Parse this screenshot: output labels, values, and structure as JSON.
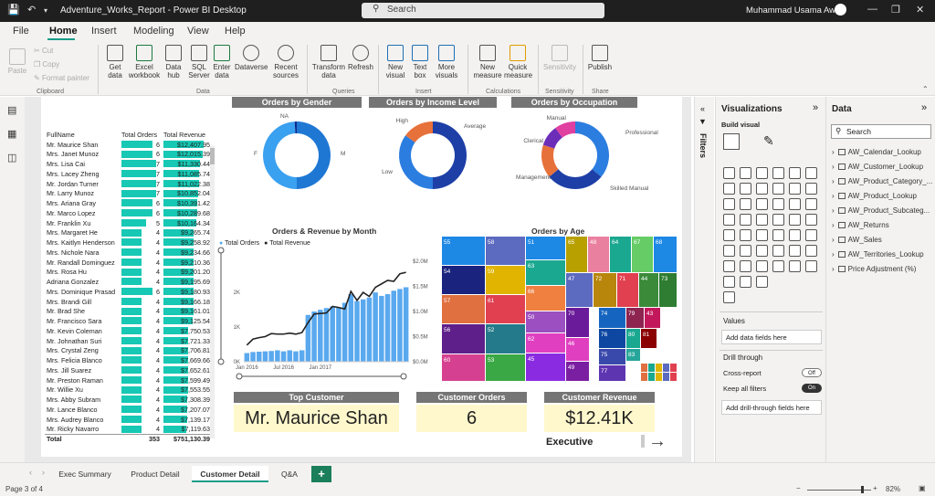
{
  "titlebar": {
    "title": "Adventure_Works_Report - Power BI Desktop",
    "search": "Search",
    "user": "Muhammad Usama Awan"
  },
  "menu": [
    "File",
    "Home",
    "Insert",
    "Modeling",
    "View",
    "Help"
  ],
  "ribbon": {
    "clipboard": {
      "paste": "Paste",
      "cut": "Cut",
      "copy": "Copy",
      "format_painter": "Format painter",
      "group": "Clipboard"
    },
    "data": {
      "get_data": "Get data",
      "excel": "Excel workbook",
      "data_hub": "Data hub",
      "sql": "SQL Server",
      "enter": "Enter data",
      "dataverse": "Dataverse",
      "recent": "Recent sources",
      "group": "Data"
    },
    "queries": {
      "transform": "Transform data",
      "refresh": "Refresh",
      "group": "Queries"
    },
    "insert": {
      "new_visual": "New visual",
      "text_box": "Text box",
      "more_visuals": "More visuals",
      "group": "Insert"
    },
    "calculations": {
      "new_measure": "New measure",
      "quick_measure": "Quick measure",
      "group": "Calculations"
    },
    "sensitivity": {
      "label": "Sensitivity",
      "group": "Sensitivity"
    },
    "share": {
      "publish": "Publish",
      "group": "Share"
    }
  },
  "table": {
    "headers": [
      "FullName",
      "Total Orders",
      "Total Revenue"
    ],
    "rows": [
      {
        "name": "Mr. Maurice Shan",
        "orders": "6",
        "revenue": "$12,407.95",
        "ob": 0.9,
        "rb": 1.0
      },
      {
        "name": "Mrs. Janet Munoz",
        "orders": "6",
        "revenue": "$12,015.39",
        "ob": 0.9,
        "rb": 0.97
      },
      {
        "name": "Mrs. Lisa Cai",
        "orders": "7",
        "revenue": "$11,330.44",
        "ob": 1.0,
        "rb": 0.91
      },
      {
        "name": "Mrs. Lacey Zheng",
        "orders": "7",
        "revenue": "$11,085.74",
        "ob": 1.0,
        "rb": 0.89
      },
      {
        "name": "Mr. Jordan Turner",
        "orders": "7",
        "revenue": "$11,022.38",
        "ob": 1.0,
        "rb": 0.89
      },
      {
        "name": "Mr. Larry Munoz",
        "orders": "7",
        "revenue": "$10,852.04",
        "ob": 1.0,
        "rb": 0.87
      },
      {
        "name": "Mrs. Ariana Gray",
        "orders": "6",
        "revenue": "$10,391.42",
        "ob": 0.9,
        "rb": 0.84
      },
      {
        "name": "Mr. Marco Lopez",
        "orders": "6",
        "revenue": "$10,289.68",
        "ob": 0.9,
        "rb": 0.83
      },
      {
        "name": "Mr. Franklin Xu",
        "orders": "5",
        "revenue": "$10,164.34",
        "ob": 0.72,
        "rb": 0.82
      },
      {
        "name": "Mrs. Margaret He",
        "orders": "4",
        "revenue": "$9,265.74",
        "ob": 0.57,
        "rb": 0.75
      },
      {
        "name": "Mrs. Kaitlyn Henderson",
        "orders": "4",
        "revenue": "$9,258.92",
        "ob": 0.57,
        "rb": 0.75
      },
      {
        "name": "Mrs. Nichole Nara",
        "orders": "4",
        "revenue": "$9,234.66",
        "ob": 0.57,
        "rb": 0.74
      },
      {
        "name": "Mr. Randall Dominguez",
        "orders": "4",
        "revenue": "$9,210.36",
        "ob": 0.57,
        "rb": 0.74
      },
      {
        "name": "Mrs. Rosa Hu",
        "orders": "4",
        "revenue": "$9,201.20",
        "ob": 0.57,
        "rb": 0.74
      },
      {
        "name": "Adriana Gonzalez",
        "orders": "4",
        "revenue": "$9,195.69",
        "ob": 0.57,
        "rb": 0.74
      },
      {
        "name": "Mrs. Dominique Prasad",
        "orders": "6",
        "revenue": "$9,180.93",
        "ob": 0.9,
        "rb": 0.74
      },
      {
        "name": "Mrs. Brandi Gill",
        "orders": "4",
        "revenue": "$9,166.18",
        "ob": 0.57,
        "rb": 0.74
      },
      {
        "name": "Mr. Brad She",
        "orders": "4",
        "revenue": "$9,161.01",
        "ob": 0.57,
        "rb": 0.74
      },
      {
        "name": "Mr. Francisco Sara",
        "orders": "4",
        "revenue": "$9,125.54",
        "ob": 0.57,
        "rb": 0.73
      },
      {
        "name": "Mr. Kevin Coleman",
        "orders": "4",
        "revenue": "$7,750.53",
        "ob": 0.57,
        "rb": 0.62
      },
      {
        "name": "Mr. Johnathan Suri",
        "orders": "4",
        "revenue": "$7,721.33",
        "ob": 0.57,
        "rb": 0.62
      },
      {
        "name": "Mrs. Crystal Zeng",
        "orders": "4",
        "revenue": "$7,706.81",
        "ob": 0.57,
        "rb": 0.62
      },
      {
        "name": "Mrs. Felicia Blanco",
        "orders": "4",
        "revenue": "$7,669.66",
        "ob": 0.57,
        "rb": 0.62
      },
      {
        "name": "Mrs. Jill Suarez",
        "orders": "4",
        "revenue": "$7,652.61",
        "ob": 0.57,
        "rb": 0.62
      },
      {
        "name": "Mr. Preston Raman",
        "orders": "4",
        "revenue": "$7,599.49",
        "ob": 0.57,
        "rb": 0.61
      },
      {
        "name": "Mr. Willie Xu",
        "orders": "4",
        "revenue": "$7,553.55",
        "ob": 0.57,
        "rb": 0.61
      },
      {
        "name": "Mrs. Abby Subram",
        "orders": "4",
        "revenue": "$7,308.39",
        "ob": 0.57,
        "rb": 0.59
      },
      {
        "name": "Mr. Lance Blanco",
        "orders": "4",
        "revenue": "$7,207.07",
        "ob": 0.57,
        "rb": 0.58
      },
      {
        "name": "Mrs. Audrey Blanco",
        "orders": "4",
        "revenue": "$7,139.17",
        "ob": 0.57,
        "rb": 0.58
      },
      {
        "name": "Mr. Ricky Navarro",
        "orders": "4",
        "revenue": "$7,119.63",
        "ob": 0.57,
        "rb": 0.57
      }
    ],
    "total": {
      "label": "Total",
      "orders": "353",
      "revenue": "$751,130.39"
    }
  },
  "donuts": [
    {
      "title": "Orders by Gender",
      "slices": [
        {
          "label": "M",
          "value": 50,
          "color": "#1f77d4"
        },
        {
          "label": "F",
          "value": 49,
          "color": "#3aa0f0"
        },
        {
          "label": "NA",
          "value": 1,
          "color": "#0a2a8a"
        }
      ]
    },
    {
      "title": "Orders by Income Level",
      "slices": [
        {
          "label": "Average",
          "value": 50,
          "color": "#1d3fa6"
        },
        {
          "label": "Low",
          "value": 35,
          "color": "#2b7de0"
        },
        {
          "label": "High",
          "value": 15,
          "color": "#e7713a"
        }
      ]
    },
    {
      "title": "Orders by Occupation",
      "slices": [
        {
          "label": "Professional",
          "value": 36,
          "color": "#2b7de0"
        },
        {
          "label": "Skilled Manual",
          "value": 28,
          "color": "#1d3fa6"
        },
        {
          "label": "Management",
          "value": 16,
          "color": "#e7713a"
        },
        {
          "label": "Clerical",
          "value": 10,
          "color": "#6c2eb9"
        },
        {
          "label": "Manual",
          "value": 10,
          "color": "#e040a0"
        }
      ]
    }
  ],
  "chart_data": [
    {
      "type": "bar",
      "title": "Orders & Revenue by Month",
      "legend": [
        "Total Orders",
        "Total Revenue"
      ],
      "x_ticks": [
        "Jan 2016",
        "Jul 2016",
        "Jan 2017"
      ],
      "y_left_ticks": [
        "0K",
        "1K",
        "2K"
      ],
      "y_right_ticks": [
        "$0.0M",
        "$0.5M",
        "$1.0M",
        "$1.5M",
        "$2.0M"
      ],
      "ylim_left": [
        0,
        2900
      ],
      "ylim_right": [
        0,
        2.0
      ],
      "series": [
        {
          "name": "Total Orders",
          "values": [
            250,
            280,
            290,
            300,
            310,
            330,
            300,
            330,
            300,
            330,
            1350,
            1450,
            1500,
            1550,
            1600,
            1560,
            1700,
            1950,
            1750,
            1800,
            1850,
            2000,
            1900,
            1950,
            2050,
            2100,
            2150
          ]
        },
        {
          "name": "Total Revenue",
          "values": [
            0.33,
            0.45,
            0.48,
            0.5,
            0.56,
            0.55,
            0.55,
            0.57,
            0.55,
            0.58,
            0.78,
            0.95,
            0.96,
            0.97,
            1.1,
            1.08,
            1.05,
            1.4,
            1.22,
            1.38,
            1.3,
            1.48,
            1.55,
            1.62,
            1.6,
            1.75,
            1.78
          ]
        }
      ]
    },
    {
      "type": "treemap",
      "title": "Orders by Age"
    }
  ],
  "cards": {
    "top_customer": {
      "label": "Top Customer",
      "value": "Mr. Maurice Shan"
    },
    "orders": {
      "label": "Customer Orders",
      "value": "6"
    },
    "revenue": {
      "label": "Customer Revenue",
      "value": "$12.41K"
    },
    "executive": "Executive"
  },
  "panes": {
    "filters": "Filters",
    "viz": {
      "title": "Visualizations",
      "build": "Build visual",
      "values": "Values",
      "add_fields": "Add data fields here",
      "drill": "Drill through",
      "cross": "Cross-report",
      "keep": "Keep all filters",
      "add_drill": "Add drill-through fields here",
      "off": "Off",
      "on": "On"
    },
    "data": {
      "title": "Data",
      "search": "Search",
      "items": [
        "AW_Calendar_Lookup",
        "AW_Customer_Lookup",
        "AW_Product_Category_...",
        "AW_Product_Lookup",
        "AW_Product_Subcateg...",
        "AW_Returns",
        "AW_Sales",
        "AW_Territories_Lookup",
        "Price Adjustment (%)"
      ]
    }
  },
  "tabs": [
    "Exec Summary",
    "Product Detail",
    "Customer Detail",
    "Q&A"
  ],
  "add_tab": "+",
  "status": {
    "page": "Page 3 of 4",
    "zoom": "82%"
  }
}
